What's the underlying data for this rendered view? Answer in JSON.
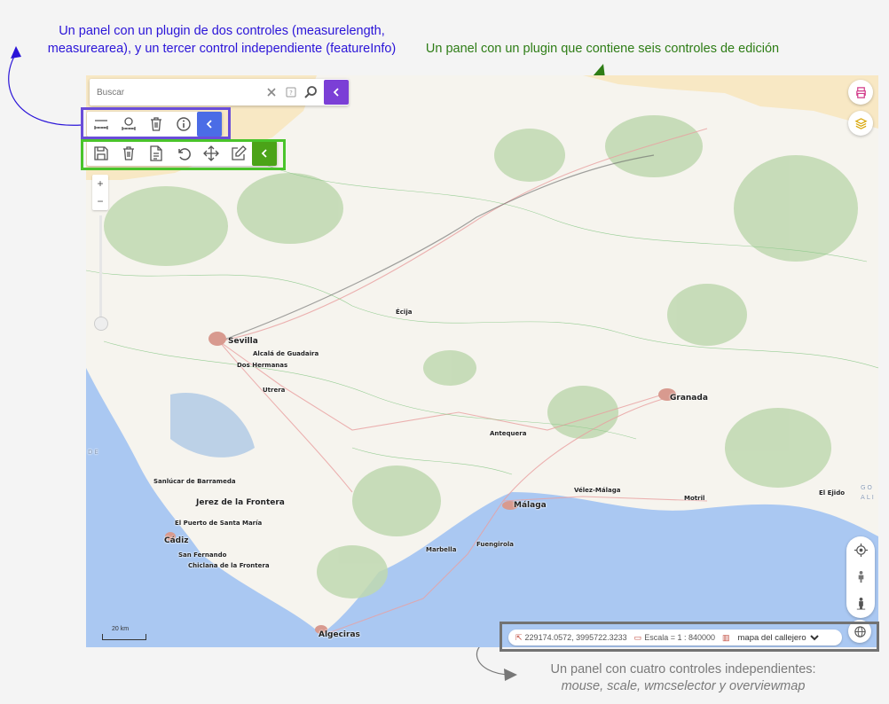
{
  "annotations": {
    "tools_panel": "Un panel con un plugin de dos controles (measurelength, measurearea), y un tercer control independiente (featureInfo)",
    "edit_panel": "Un panel con un plugin que contiene seis controles de edición",
    "status_panel_line1": "Un panel con cuatro controles independientes:",
    "status_panel_line2": "mouse, scale, wmcselector y overviewmap"
  },
  "colors": {
    "annot_blue": "#2a14d8",
    "annot_green": "#2e7d16",
    "search_toggle": "#7b3fd6",
    "tools_toggle": "#4b6ce6",
    "edit_toggle": "#4ba318",
    "sea": "#aac8f2",
    "land": "#f6f4ee"
  },
  "search": {
    "placeholder": "Buscar"
  },
  "tools_panel": {
    "buttons": [
      "measure-length-icon",
      "measure-area-icon",
      "delete-icon",
      "info-icon"
    ]
  },
  "edit_panel": {
    "buttons": [
      "save-icon",
      "delete-icon",
      "file-icon",
      "undo-icon",
      "move-icon",
      "edit-icon"
    ]
  },
  "zoom": {
    "in": "+",
    "out": "−"
  },
  "status": {
    "coordinates": "229174.0572, 3995722.3233",
    "scale": "Escala = 1 : 840000",
    "wmc_selected": "mapa del callejero"
  },
  "scale_bar": "20 km",
  "places": [
    "Sevilla",
    "Alcalá de Guadaira",
    "Dos Hermanas",
    "Utrera",
    "Écija",
    "Granada",
    "Antequera",
    "Sanlúcar de Barrameda",
    "Jerez de la Frontera",
    "El Puerto de Santa María",
    "Cádiz",
    "San Fernando",
    "Chiclana de la Frontera",
    "Málaga",
    "Vélez-Málaga",
    "Motril",
    "El Ejido",
    "Marbella",
    "Fuengirola",
    "Algeciras"
  ],
  "edge_labels": {
    "left": "DE",
    "right_1": "GO",
    "right_2": "ALI"
  }
}
